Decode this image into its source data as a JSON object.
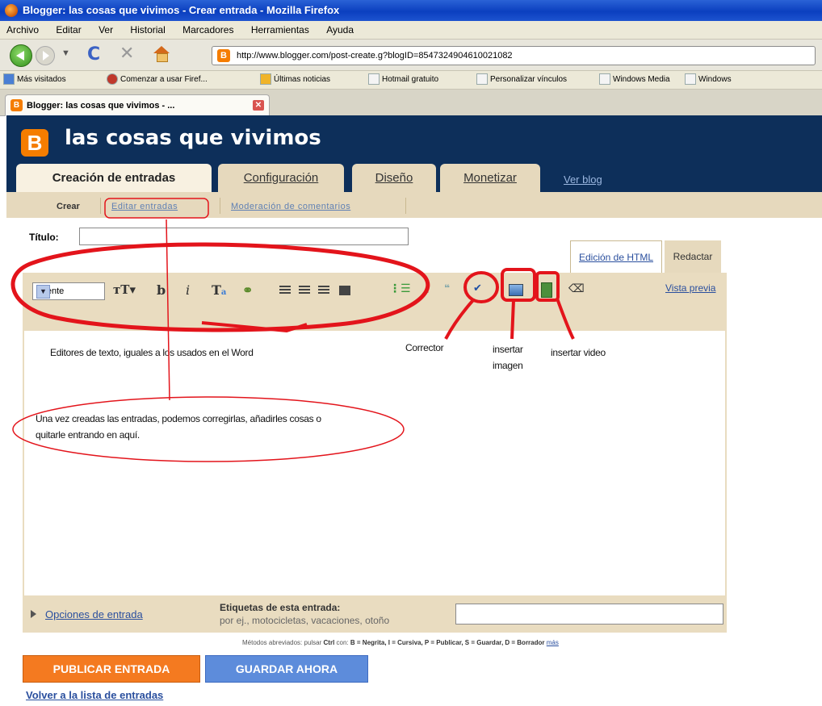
{
  "browser": {
    "window_title": "Blogger: las cosas que vivimos - Crear entrada - Mozilla Firefox",
    "menu": [
      "Archivo",
      "Editar",
      "Ver",
      "Historial",
      "Marcadores",
      "Herramientas",
      "Ayuda"
    ],
    "url": "http://www.blogger.com/post-create.g?blogID=8547324904610021082",
    "bookmarks": [
      "Más visitados",
      "Comenzar a usar Firef...",
      "Últimas noticias",
      "Hotmail gratuito",
      "Personalizar vínculos",
      "Windows Media",
      "Windows"
    ],
    "tab_label": "Blogger: las cosas que vivimos - ...",
    "tab_close": "✕"
  },
  "blog": {
    "logo": "B",
    "title": "las cosas que vivimos",
    "tabs": [
      "Creación de entradas",
      "Configuración",
      "Diseño",
      "Monetizar"
    ],
    "view_blog": "Ver blog"
  },
  "subnav": {
    "crear": "Crear",
    "editar": "Editar entradas",
    "moderacion": "Moderación de comentarios"
  },
  "form": {
    "titulo_label": "Título:",
    "titulo_value": "",
    "tab_html": "Edición de HTML",
    "tab_redactar": "Redactar",
    "font_select": "Fuente",
    "vista_previa": "Vista previa",
    "options_link": "Opciones de entrada",
    "labels_title": "Etiquetas de esta entrada:",
    "labels_hint": "por ej., motocicletas, vacaciones, otoño",
    "labels_value": ""
  },
  "shortcuts": {
    "prefix": "Métodos abreviados: pulsar",
    "ctrl": "Ctrl",
    "con": "con:",
    "items": "B = Negrita, I = Cursiva, P = Publicar, S = Guardar, D = Borrador",
    "more": "más"
  },
  "buttons": {
    "publicar": "PUBLICAR ENTRADA",
    "guardar": "GUARDAR AHORA",
    "volver": "Volver a la lista de entradas"
  },
  "annotations": {
    "editores": "Editores de texto, iguales a los usados en el Word",
    "corrector": "Corrector",
    "insertar_imagen_1": "insertar",
    "insertar_imagen_2": "imagen",
    "insertar_video": "insertar video",
    "una_vez_1": "Una vez creadas las entradas, podemos corregirlas, añadirles cosas o",
    "una_vez_2": "quitarle entrando en aquí."
  },
  "colors": {
    "blogger_orange": "#f57d00",
    "header_navy": "#0d2f5a",
    "annotation_red": "#e3141b"
  }
}
